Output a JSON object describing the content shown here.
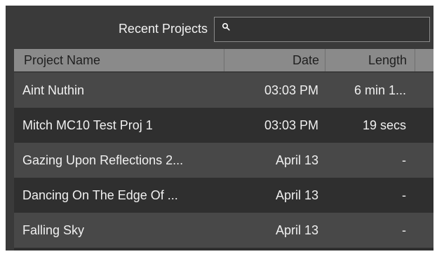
{
  "header": {
    "title": "Recent Projects",
    "search_value": "",
    "search_placeholder": ""
  },
  "table": {
    "columns": [
      "Project Name",
      "Date",
      "Length"
    ],
    "rows": [
      {
        "name": "Aint Nuthin",
        "date": "03:03 PM",
        "length": "6 min 1..."
      },
      {
        "name": "Mitch MC10 Test Proj 1",
        "date": "03:03 PM",
        "length": "19 secs"
      },
      {
        "name": "Gazing Upon Reflections 2...",
        "date": "April 13",
        "length": "-"
      },
      {
        "name": "Dancing On The Edge Of ...",
        "date": "April 13",
        "length": "-"
      },
      {
        "name": "Falling Sky",
        "date": "April 13",
        "length": "-"
      }
    ]
  },
  "icons": {
    "search": "search-icon"
  },
  "colors": {
    "panel_bg": "#3a3a3a",
    "header_bg": "#8a8a8a",
    "row_odd": "#484848",
    "row_even": "#2f2f2f",
    "text": "#f0f0f0",
    "header_text": "#1f1f1f"
  }
}
